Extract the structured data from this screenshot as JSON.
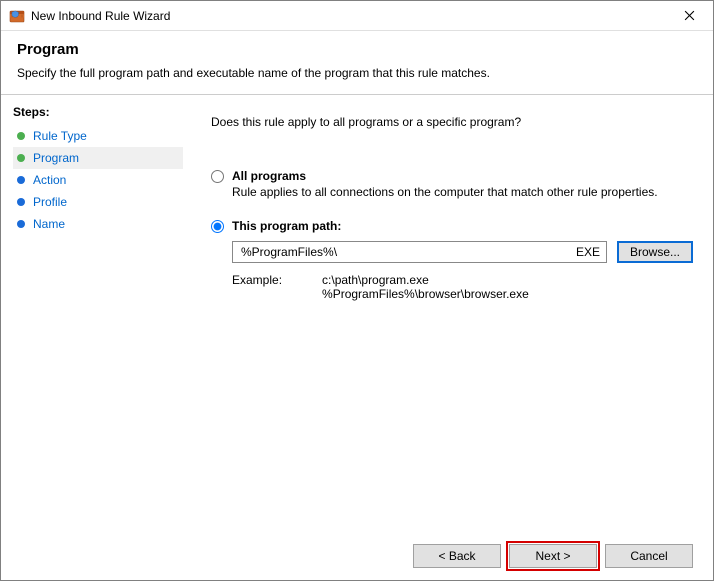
{
  "window": {
    "title": "New Inbound Rule Wizard"
  },
  "header": {
    "title": "Program",
    "description": "Specify the full program path and executable name of the program that this rule matches."
  },
  "sidebar": {
    "steps_label": "Steps:",
    "items": [
      {
        "label": "Rule Type",
        "bullet": "green",
        "active": false
      },
      {
        "label": "Program",
        "bullet": "green",
        "active": true
      },
      {
        "label": "Action",
        "bullet": "blue",
        "active": false
      },
      {
        "label": "Profile",
        "bullet": "blue",
        "active": false
      },
      {
        "label": "Name",
        "bullet": "blue",
        "active": false
      }
    ]
  },
  "main": {
    "question": "Does this rule apply to all programs or a specific program?",
    "option_all": {
      "label": "All programs",
      "desc": "Rule applies to all connections on the computer that match other rule properties."
    },
    "option_path": {
      "label": "This program path:",
      "value": "%ProgramFiles%\\",
      "ext": "EXE",
      "browse": "Browse..."
    },
    "example": {
      "label": "Example:",
      "lines": "c:\\path\\program.exe\n%ProgramFiles%\\browser\\browser.exe"
    }
  },
  "buttons": {
    "back": "< Back",
    "next": "Next >",
    "cancel": "Cancel"
  }
}
